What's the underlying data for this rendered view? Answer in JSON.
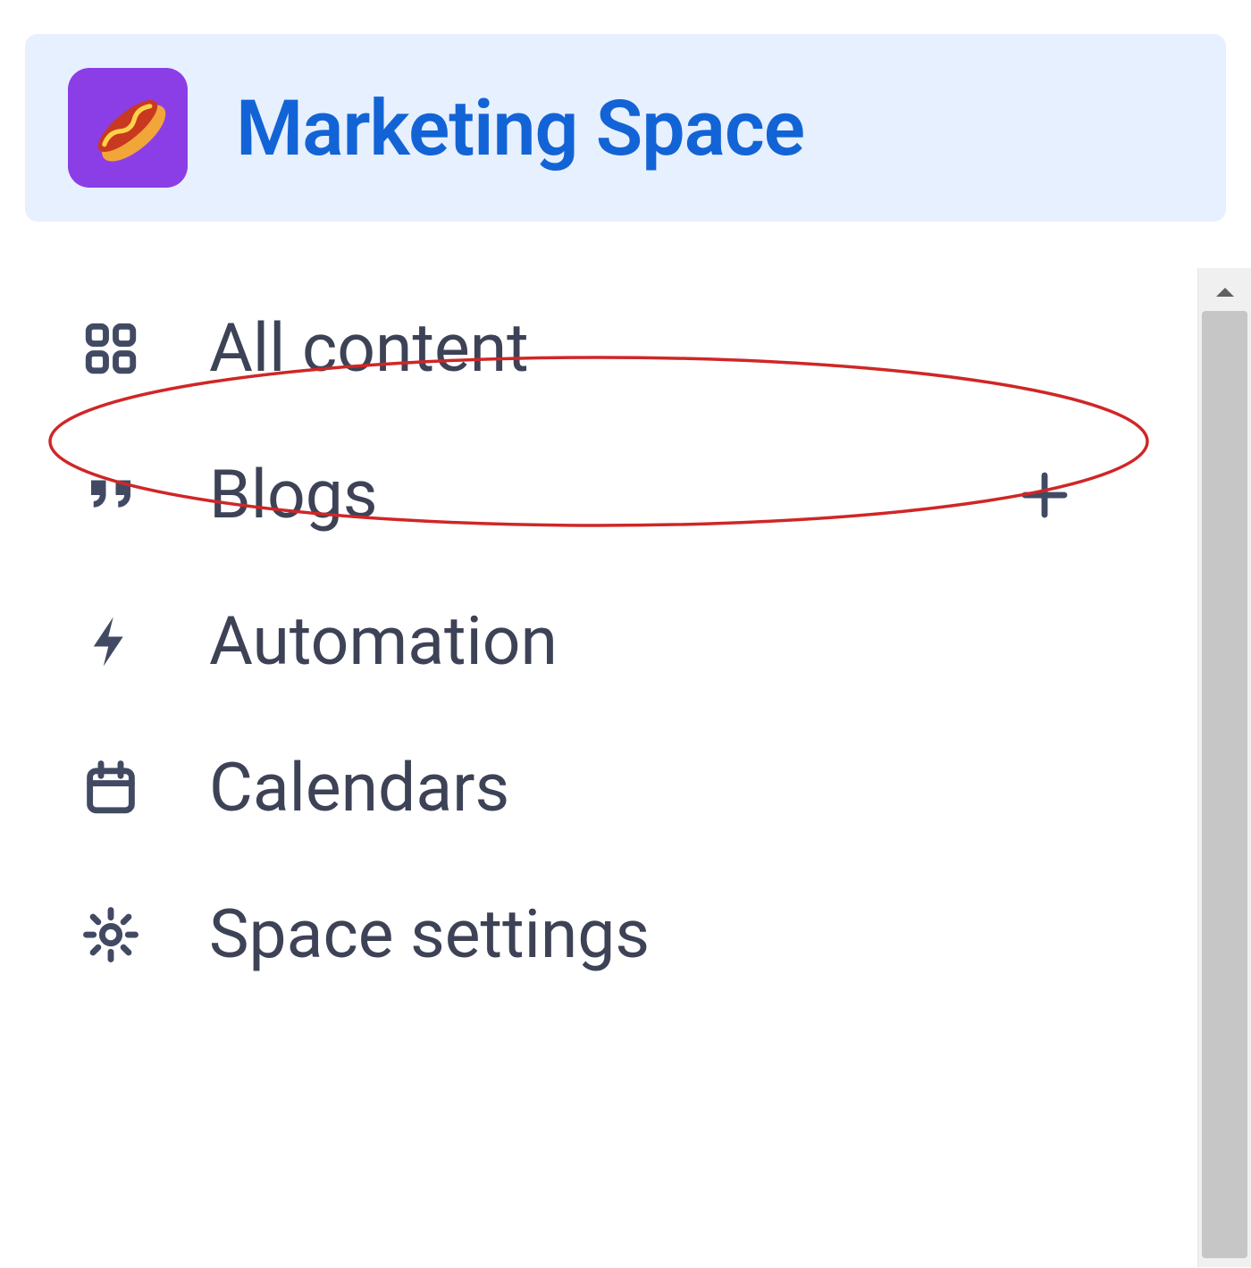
{
  "space": {
    "title": "Marketing Space",
    "icon_name": "hotdog-icon",
    "icon_bg": "#8c3ee6"
  },
  "nav": {
    "items": [
      {
        "icon": "grid-icon",
        "label": "All content",
        "has_add": false
      },
      {
        "icon": "quote-icon",
        "label": "Blogs",
        "has_add": true,
        "highlighted": true
      },
      {
        "icon": "bolt-icon",
        "label": "Automation",
        "has_add": false
      },
      {
        "icon": "calendar-icon",
        "label": "Calendars",
        "has_add": false
      },
      {
        "icon": "gear-icon",
        "label": "Space settings",
        "has_add": false
      }
    ]
  },
  "annotation": {
    "ellipse_color": "#d02626"
  }
}
